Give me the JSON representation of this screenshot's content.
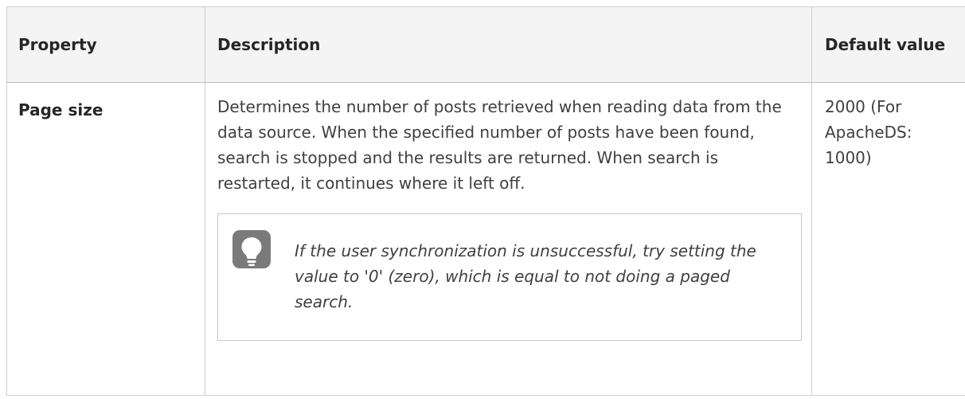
{
  "table": {
    "headers": {
      "property": "Property",
      "description": "Description",
      "default_value": "Default value"
    },
    "rows": [
      {
        "property": "Page size",
        "description": "Determines the number of posts retrieved when reading data from the data source. When the specified number of posts have been found, search is stopped and the results are returned. When search is restarted, it continues where it left off.",
        "default_value": "2000 (For ApacheDS: 1000)",
        "tip": {
          "icon": "lightbulb-icon",
          "text": "If the user synchronization is unsuccessful, try setting the value to '0' (zero), which is equal to not doing a paged search."
        }
      }
    ]
  },
  "colors": {
    "border": "#cfcfcf",
    "header_bg": "#f4f4f4",
    "text": "#404040",
    "icon_bg": "#7a7a7a"
  }
}
